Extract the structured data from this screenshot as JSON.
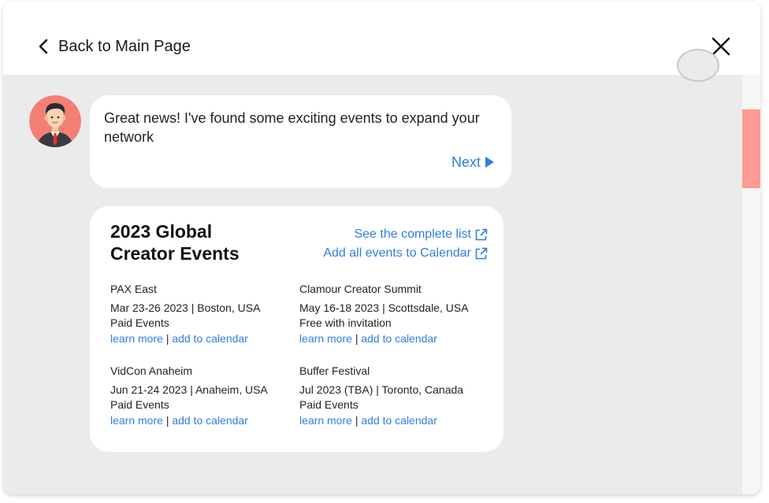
{
  "header": {
    "back_label": "Back to Main Page"
  },
  "chat": {
    "message": "Great news! I've found some exciting events to expand your network",
    "next_label": "Next"
  },
  "card": {
    "title": "2023 Global Creator Events",
    "see_list_label": "See the complete list",
    "add_all_label": "Add all events to Calendar",
    "events": [
      {
        "name": "PAX East",
        "details": "Mar 23-26 2023 | Boston, USA",
        "type": "Paid Events",
        "learn_more": "learn more",
        "separator": "|",
        "add_to_calendar": "add to calendar"
      },
      {
        "name": "Clamour Creator Summit",
        "details": "May 16-18 2023 | Scottsdale, USA",
        "type": "Free with invitation",
        "learn_more": "learn more",
        "separator": "|",
        "add_to_calendar": "add to calendar"
      },
      {
        "name": "VidCon Anaheim",
        "details": "Jun 21-24 2023 | Anaheim, USA",
        "type": "Paid Events",
        "learn_more": "learn more",
        "separator": "|",
        "add_to_calendar": "add to calendar"
      },
      {
        "name": "Buffer Festival",
        "details": "Jul 2023 (TBA) | Toronto, Canada",
        "type": "Paid Events",
        "learn_more": "learn more",
        "separator": "|",
        "add_to_calendar": "add to calendar"
      }
    ]
  },
  "icons": {
    "back": "chevron-left-icon",
    "close": "close-icon",
    "next": "play-triangle-icon",
    "external": "external-link-icon",
    "avatar": "assistant-avatar"
  },
  "colors": {
    "accent": "#2f7fe0",
    "scroll_thumb": "#ff9a95",
    "avatar_bg": "#f47f74",
    "background": "#ebebeb"
  }
}
